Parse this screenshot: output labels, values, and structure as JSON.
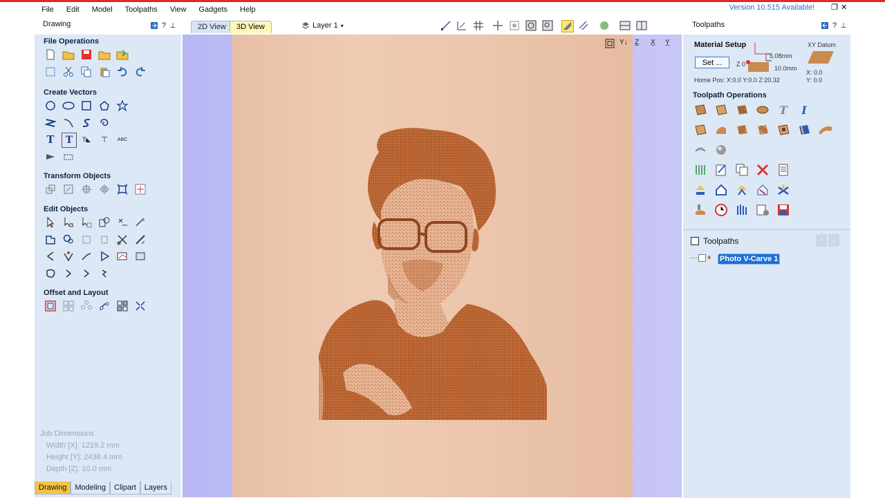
{
  "menu": [
    "File",
    "Edit",
    "Model",
    "Toolpaths",
    "View",
    "Gadgets",
    "Help"
  ],
  "version_notice": "Version 10.515 Available!",
  "window_controls": {
    "restore": "❐",
    "close": "✕"
  },
  "left_panel": {
    "title": "Drawing",
    "sections": {
      "file_ops": "File Operations",
      "create_vectors": "Create Vectors",
      "transform": "Transform Objects",
      "edit_objects": "Edit Objects",
      "offset_layout": "Offset and Layout"
    },
    "job_dims": {
      "title": "Job Dimensions",
      "width": "Width  [X]: 1219.2 mm",
      "height": "Height [Y]: 2438.4 mm",
      "depth": "Depth  [Z]: 10.0 mm"
    },
    "bottom_tabs": [
      "Drawing",
      "Modeling",
      "Clipart",
      "Layers"
    ]
  },
  "view_tabs": {
    "tab_2d": "2D View",
    "tab_3d": "3D View"
  },
  "layer": "Layer 1",
  "right_panel": {
    "title": "Toolpaths",
    "material_setup": "Material Setup",
    "set_button": "Set ...",
    "z_label": "Z 0",
    "thickness_top": "5.08mm",
    "thickness_bottom": "10.0mm",
    "home_pos": "Home Pos:  X:0.0 Y:0.0 Z:20.32",
    "xy_datum": "XY Datum",
    "datum_x": "X: 0.0",
    "datum_y": "Y: 0.0",
    "toolpath_ops": "Toolpath Operations",
    "toolpaths_list_title": "Toolpaths",
    "toolpath_item": "Photo V-Carve 1"
  },
  "colors": {
    "accent": "#1e6fd8",
    "panel": "#dce8f5",
    "carve": "#b5602e",
    "wood": "#ecc6ad"
  }
}
